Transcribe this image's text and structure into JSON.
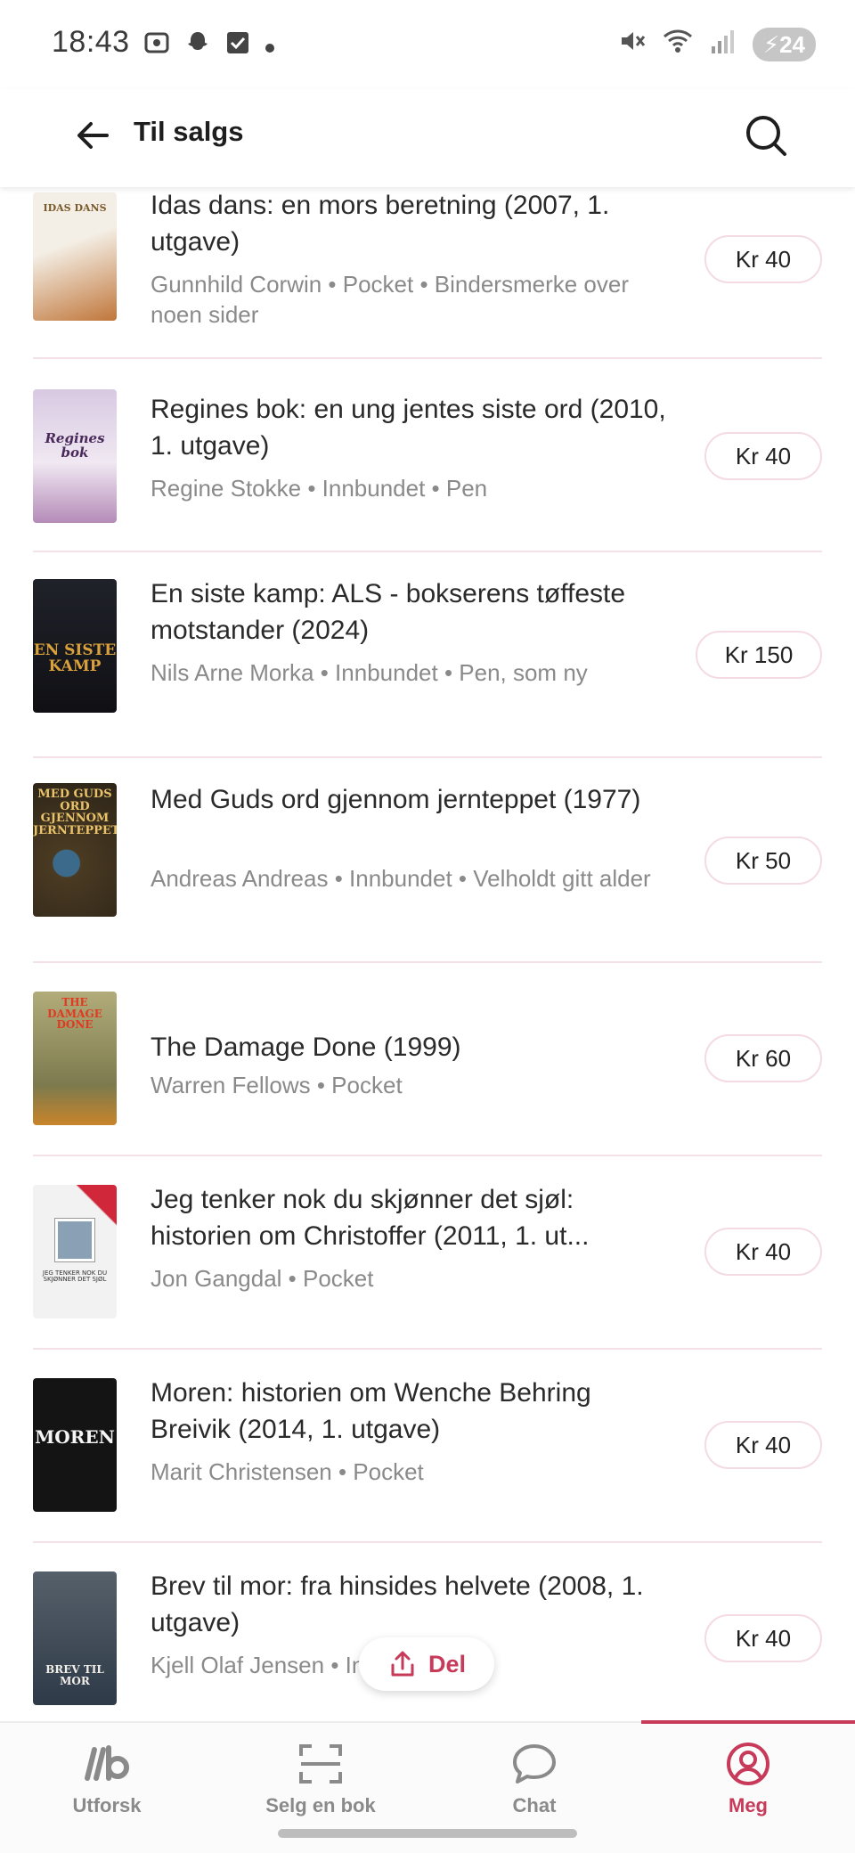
{
  "status_bar": {
    "time": "18:43",
    "battery": "24",
    "left_icons": [
      "screenshot-icon",
      "snapchat-icon",
      "checkbox-icon",
      "dot-icon"
    ],
    "right_icons": [
      "mute-icon",
      "wifi-icon",
      "signal-icon",
      "battery-charging-icon"
    ]
  },
  "header": {
    "title": "Til salgs",
    "back_icon": "arrow-left-icon",
    "search_icon": "search-icon"
  },
  "listings": [
    {
      "title": "Idas dans: en mors beretning (2007, 1. utgave)",
      "meta": "Gunnhild Corwin • Pocket • Bindersmerke over noen sider",
      "price": "Kr 40",
      "cover_text": "IDAS DANS",
      "cover_colors": [
        "#f4efe6",
        "#c0763a"
      ]
    },
    {
      "title": "Regines bok: en ung jentes siste ord (2010, 1. utgave)",
      "meta": "Regine Stokke • Innbundet • Pen",
      "price": "Kr 40",
      "cover_text": "Regines bok",
      "cover_colors": [
        "#e4d6e8",
        "#6b3f7a"
      ]
    },
    {
      "title": "En siste kamp: ALS - bokserens tøffeste motstander (2024)",
      "meta": "Nils Arne Morka • Innbundet • Pen, som ny",
      "price": "Kr 150",
      "cover_text": "EN SISTE KAMP",
      "cover_colors": [
        "#1c1c22",
        "#d9a13a"
      ]
    },
    {
      "title": "Med Guds ord gjennom jernteppet (1977)",
      "meta": "Andreas Andreas • Innbundet • Velholdt gitt alder",
      "price": "Kr 50",
      "cover_text": "MED GUDS ORD GJENNOM JERNTEPPET",
      "cover_colors": [
        "#4a3a22",
        "#e9c26a"
      ]
    },
    {
      "title": "The Damage Done (1999)",
      "meta": "Warren Fellows • Pocket",
      "price": "Kr 60",
      "cover_text": "THE DAMAGE DONE",
      "cover_colors": [
        "#8c8a5a",
        "#e0a030"
      ]
    },
    {
      "title": "Jeg tenker nok du skjønner det sjøl: historien om Christoffer (2011, 1. ut...",
      "meta": "Jon Gangdal • Pocket",
      "price": "Kr 40",
      "cover_text": "JEG TENKER NOK DU SKJØNNER DET SJØL",
      "cover_colors": [
        "#f2f2f2",
        "#d0283a"
      ]
    },
    {
      "title": "Moren: historien om Wenche Behring Breivik (2014, 1. utgave)",
      "meta": "Marit Christensen • Pocket",
      "price": "Kr 40",
      "cover_text": "MOREN",
      "cover_colors": [
        "#141414",
        "#f5f5f5"
      ]
    },
    {
      "title": "Brev til mor: fra hinsides helvete (2008, 1. utgave)",
      "meta": "Kjell Olaf Jensen • Innbundet",
      "price": "Kr 40",
      "cover_text": "BREV TIL MOR",
      "cover_colors": [
        "#2e3a48",
        "#f1efe8"
      ]
    }
  ],
  "share": {
    "label": "Del",
    "icon": "share-upload-icon"
  },
  "bottom_nav": [
    {
      "label": "Utforsk",
      "icon": "logo-ib-icon",
      "active": false
    },
    {
      "label": "Selg en bok",
      "icon": "scan-icon",
      "active": false
    },
    {
      "label": "Chat",
      "icon": "chat-bubble-icon",
      "active": false
    },
    {
      "label": "Meg",
      "icon": "profile-icon",
      "active": true
    }
  ],
  "colors": {
    "accent": "#c73a5a",
    "divider": "#f3e1e6",
    "muted_text": "#8a8a8a"
  }
}
